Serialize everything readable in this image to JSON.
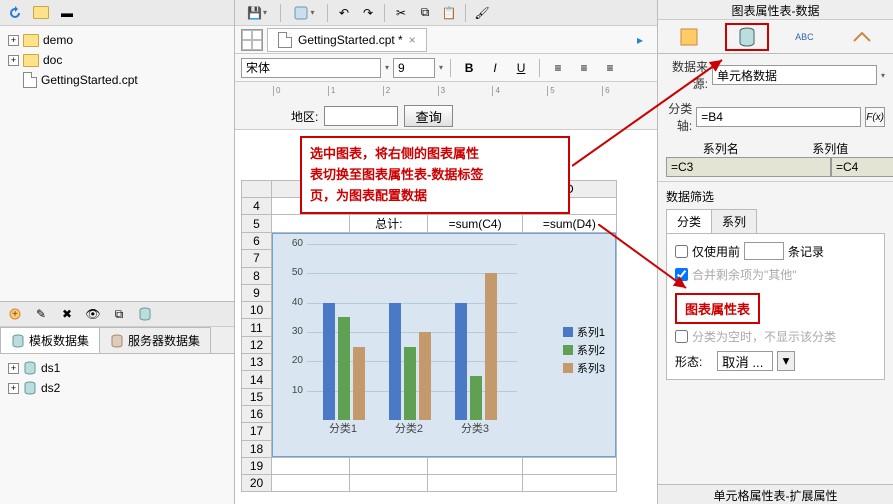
{
  "left": {
    "tree": [
      {
        "type": "folder",
        "name": "demo"
      },
      {
        "type": "folder",
        "name": "doc"
      },
      {
        "type": "file",
        "name": "GettingStarted.cpt"
      }
    ],
    "ds_tabs": {
      "template": "模板数据集",
      "server": "服务器数据集"
    },
    "ds_items": [
      "ds1",
      "ds2"
    ]
  },
  "center": {
    "tab_file": "GettingStarted.cpt *",
    "font_name": "宋体",
    "font_size": "9",
    "param_label": "地区:",
    "param_btn": "查询",
    "annot1_l1": "选中图表，将右侧的图表属性",
    "annot1_l2": "表切换至图表属性表-数据标签",
    "annot1_l3": "页，为图表配置数据",
    "col_headers": [
      "A",
      "B",
      "C",
      "D"
    ],
    "row5": {
      "b": "总计:",
      "c": "=sum(C4)",
      "d": "=sum(D4)"
    }
  },
  "right": {
    "title": "图表属性表-数据",
    "data_from_lbl": "数据来源:",
    "data_from_val": "单元格数据",
    "cat_axis_lbl": "分类轴:",
    "cat_axis_val": "=B4",
    "series_name_lbl": "系列名",
    "series_val_lbl": "系列值",
    "series_name_v": "=C3",
    "series_val_v": "=C4",
    "filter_title": "数据筛选",
    "tab_cat": "分类",
    "tab_ser": "系列",
    "only_top_lbl": "仅使用前",
    "records_lbl": "条记录",
    "merge_other_lbl": "合并剩余项为\"其他\"",
    "annot2": "图表属性表",
    "hide_empty_lbl": "分类为空时，不显示该分类",
    "shape_lbl": "形态:",
    "shape_val": "取消 ...",
    "bottom_title": "单元格属性表-扩展属性"
  },
  "chart_data": {
    "type": "bar",
    "categories": [
      "分类1",
      "分类2",
      "分类3"
    ],
    "series": [
      {
        "name": "系列1",
        "values": [
          40,
          40,
          40
        ],
        "color": "#4a79c5"
      },
      {
        "name": "系列2",
        "values": [
          35,
          25,
          15
        ],
        "color": "#5fa053"
      },
      {
        "name": "系列3",
        "values": [
          25,
          30,
          50
        ],
        "color": "#c49a6c"
      }
    ],
    "ylim": [
      0,
      60
    ],
    "yticks": [
      10,
      20,
      30,
      40,
      50,
      60
    ],
    "title": "",
    "xlabel": "",
    "ylabel": ""
  }
}
